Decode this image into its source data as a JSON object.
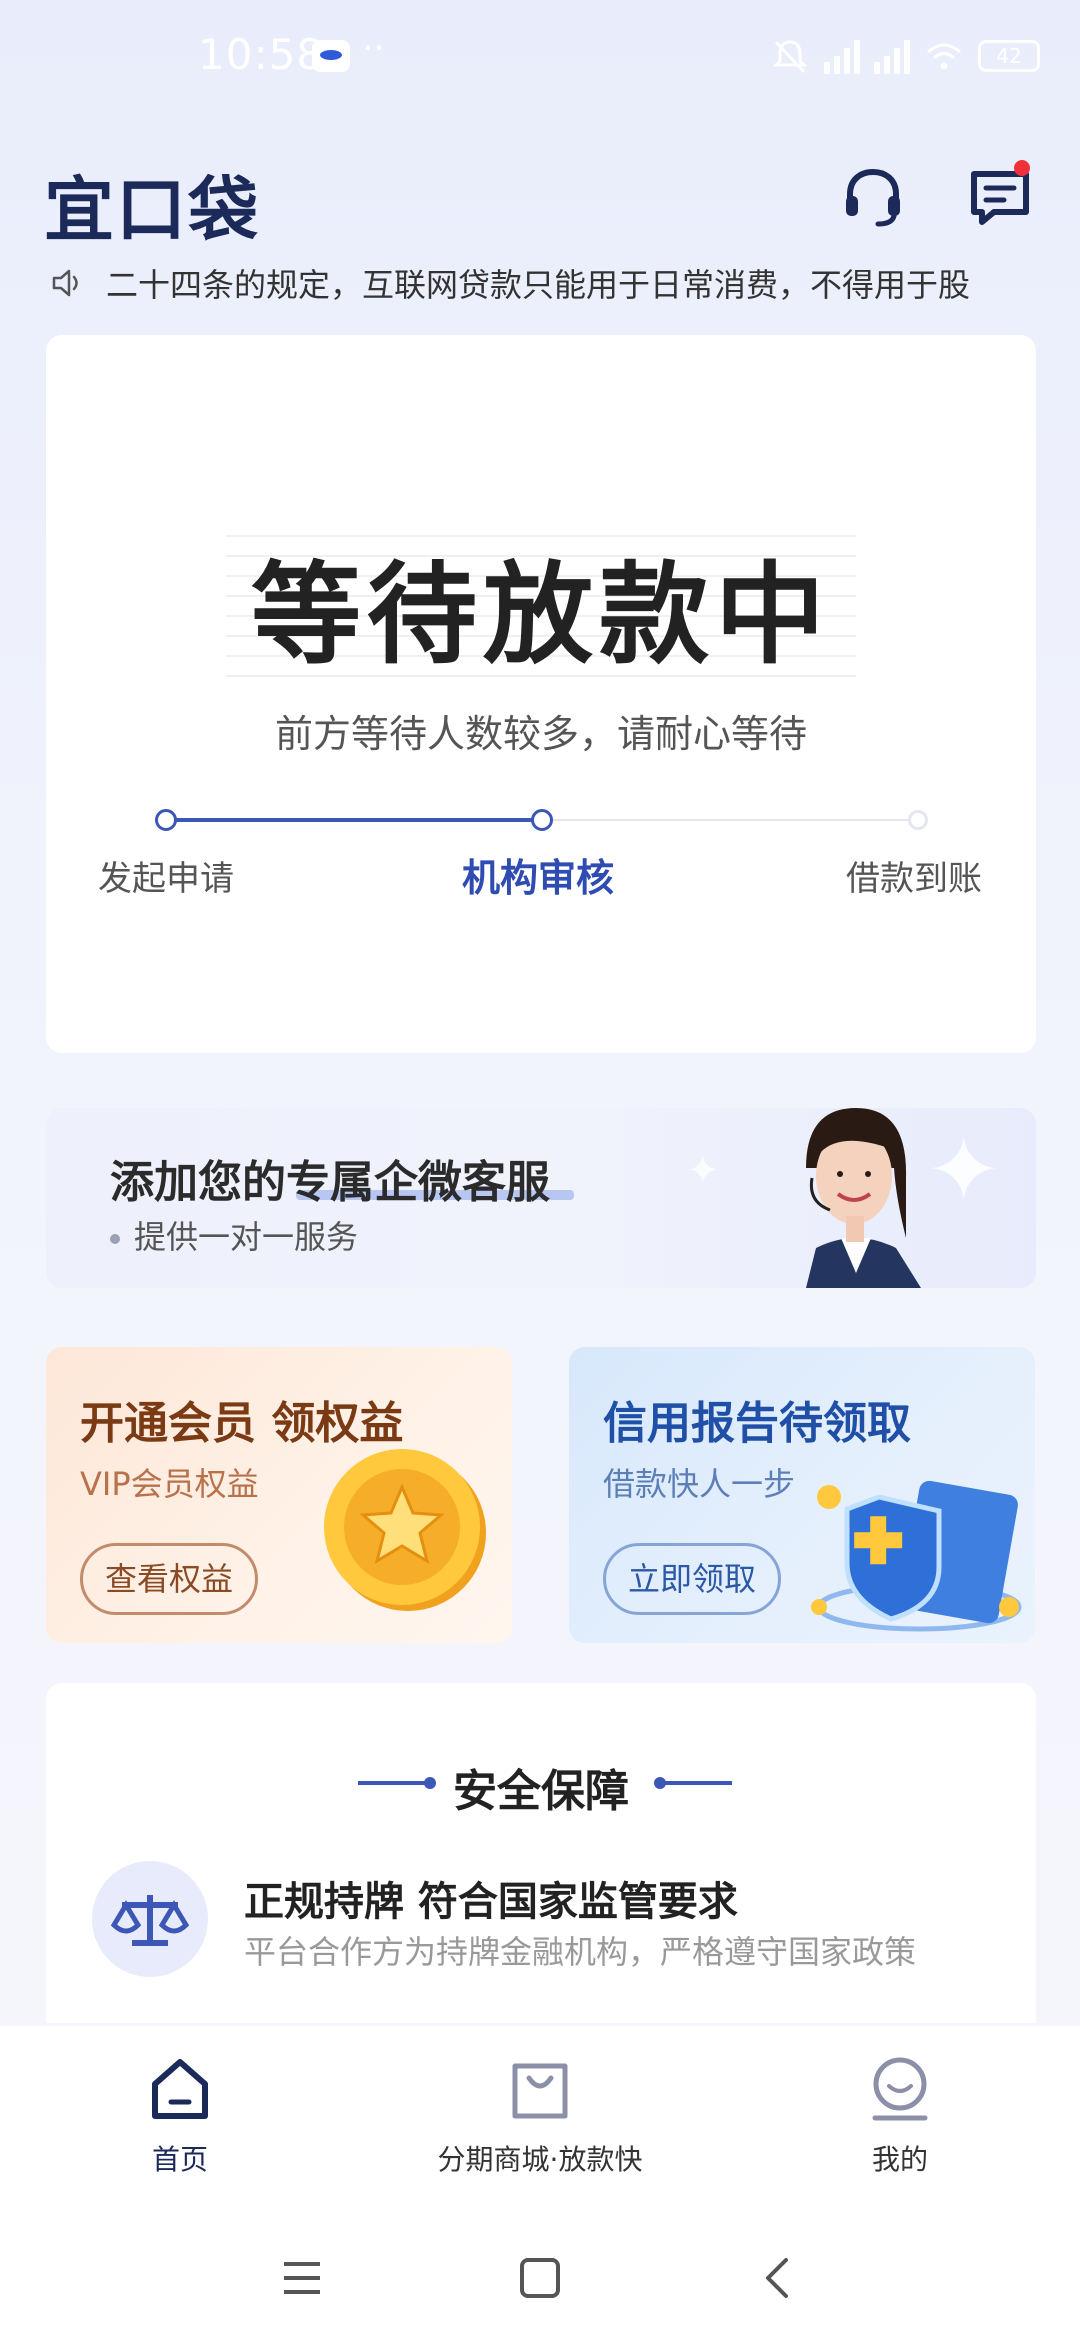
{
  "status_bar": {
    "time": "10:58",
    "dots": "··",
    "battery": "42"
  },
  "header": {
    "logo": "宜口袋",
    "support_icon": "headset-icon",
    "message_icon": "message-icon"
  },
  "notice": {
    "icon": "speaker-icon",
    "text": "二十四条的规定，互联网贷款只能用于日常消费，不得用于股"
  },
  "loan_status": {
    "title": "等待放款中",
    "subtitle": "前方等待人数较多，请耐心等待",
    "steps": [
      "发起申请",
      "机构审核",
      "借款到账"
    ],
    "current_step": 2,
    "progress_fraction": 0.5
  },
  "service_banner": {
    "title": "添加您的专属企微客服",
    "subtitle": "提供一对一服务"
  },
  "promos": {
    "vip": {
      "title": "开通会员 领权益",
      "subtitle": "VIP会员权益",
      "button": "查看权益"
    },
    "credit": {
      "title": "信用报告待领取",
      "subtitle": "借款快人一步",
      "button": "立即领取"
    }
  },
  "safety": {
    "heading": "安全保障",
    "item_title": "正规持牌 符合国家监管要求",
    "item_desc": "平台合作方为持牌金融机构，严格遵守国家政策"
  },
  "bottom_nav": {
    "home": "首页",
    "mall": "分期商城·放款快",
    "mine": "我的"
  },
  "colors": {
    "accent": "#3c57b5",
    "brand_dark": "#1c2a5a",
    "notification_dot": "#f0313a"
  }
}
